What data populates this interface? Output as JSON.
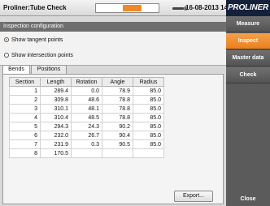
{
  "titlebar": {
    "app_title": "Proliner:Tube Check",
    "datetime": "16-08-2013 14:58:20",
    "probe_icon": "probe-icon"
  },
  "logo": {
    "text": "PROLINER"
  },
  "menu": {
    "items": [
      {
        "label": "Measure",
        "active": false
      },
      {
        "label": "Inspect",
        "active": true
      },
      {
        "label": "Master data",
        "active": false
      },
      {
        "label": "Check",
        "active": false
      }
    ],
    "close_label": "Close"
  },
  "inspection": {
    "header": "Inspection configuration",
    "options": [
      {
        "label": "Show tangent points",
        "checked": true
      },
      {
        "label": "Show intersection points",
        "checked": false
      }
    ]
  },
  "tabs": [
    {
      "label": "Bends",
      "active": true
    },
    {
      "label": "Positions",
      "active": false
    }
  ],
  "table": {
    "columns": [
      "Section",
      "Length",
      "Rotation",
      "Angle",
      "Radius"
    ],
    "rows": [
      [
        "1",
        "289.4",
        "0.0",
        "78.9",
        "85.0"
      ],
      [
        "2",
        "309.8",
        "48.6",
        "78.8",
        "85.0"
      ],
      [
        "3",
        "310.1",
        "48.1",
        "78.8",
        "85.0"
      ],
      [
        "4",
        "310.4",
        "48.5",
        "78.8",
        "85.0"
      ],
      [
        "5",
        "294.3",
        "24.3",
        "90.2",
        "85.0"
      ],
      [
        "6",
        "232.0",
        "26.7",
        "90.4",
        "85.0"
      ],
      [
        "7",
        "231.9",
        "0.3",
        "90.5",
        "85.0"
      ],
      [
        "8",
        "170.5",
        "",
        "",
        ""
      ]
    ]
  },
  "export_label": "Export...",
  "colors": {
    "accent": "#e8801e",
    "brand": "#14213b",
    "header": "#6f6f6f"
  }
}
